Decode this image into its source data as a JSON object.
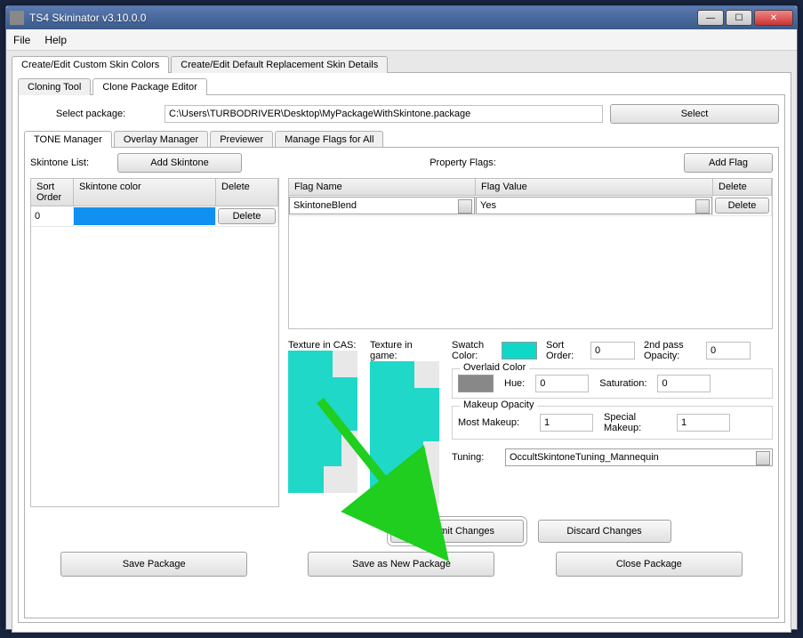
{
  "window": {
    "title": "TS4 Skininator v3.10.0.0"
  },
  "menu": {
    "file": "File",
    "help": "Help"
  },
  "mainTabs": {
    "createCustom": "Create/Edit Custom Skin Colors",
    "createDefault": "Create/Edit Default Replacement Skin Details"
  },
  "subTabs": {
    "cloningTool": "Cloning Tool",
    "clonePackageEditor": "Clone Package Editor"
  },
  "selectPackage": {
    "label": "Select package:",
    "path": "C:\\Users\\TURBODRIVER\\Desktop\\MyPackageWithSkintone.package",
    "button": "Select"
  },
  "editorTabs": {
    "toneManager": "TONE Manager",
    "overlayManager": "Overlay Manager",
    "previewer": "Previewer",
    "manageFlags": "Manage Flags for All"
  },
  "skintoneList": {
    "label": "Skintone List:",
    "addButton": "Add Skintone",
    "cols": {
      "sortOrder": "Sort Order",
      "color": "Skintone color",
      "delete": "Delete"
    },
    "rows": [
      {
        "order": "0",
        "color": "#1090f0",
        "delete": "Delete"
      }
    ]
  },
  "propertyFlags": {
    "label": "Property Flags:",
    "addButton": "Add Flag",
    "cols": {
      "name": "Flag Name",
      "value": "Flag Value",
      "delete": "Delete"
    },
    "rows": [
      {
        "name": "SkintoneBlend",
        "value": "Yes",
        "delete": "Delete"
      }
    ]
  },
  "texture": {
    "casLabel": "Texture in CAS:",
    "gameLabel": "Texture in game:"
  },
  "props": {
    "swatchLabel": "Swatch Color:",
    "swatchColor": "#10d8c8",
    "sortOrderLabel": "Sort Order:",
    "sortOrderVal": "0",
    "secondPassLabel": "2nd pass Opacity:",
    "secondPassVal": "0",
    "overlaidTitle": "Overlaid Color",
    "overlaidColor": "#888888",
    "hueLabel": "Hue:",
    "hueVal": "0",
    "satLabel": "Saturation:",
    "satVal": "0",
    "makeupTitle": "Makeup Opacity",
    "mostMakeupLabel": "Most Makeup:",
    "mostMakeupVal": "1",
    "specialMakeupLabel": "Special Makeup:",
    "specialMakeupVal": "1",
    "tuningLabel": "Tuning:",
    "tuningVal": "OccultSkintoneTuning_Mannequin"
  },
  "actions": {
    "commit": "Commit Changes",
    "discard": "Discard Changes"
  },
  "bottom": {
    "save": "Save Package",
    "saveAs": "Save as New Package",
    "close": "Close Package"
  }
}
